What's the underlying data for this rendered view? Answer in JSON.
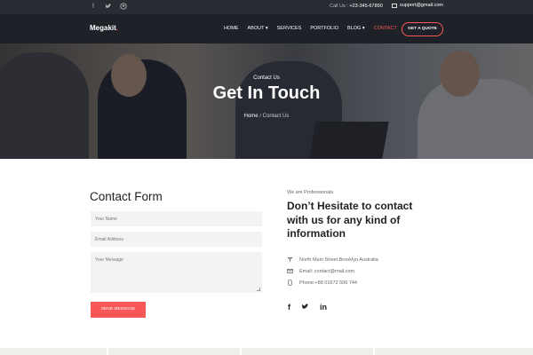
{
  "topbar": {
    "social_icons": [
      "facebook-icon",
      "twitter-icon",
      "github-icon"
    ],
    "call_label": "Call Us : ",
    "phone": "+23-345-67890",
    "email": "support@gmail.com"
  },
  "nav": {
    "logo_main": "Megakit",
    "logo_dot": ".",
    "items": [
      {
        "label": "HOME"
      },
      {
        "label": "ABOUT ▾"
      },
      {
        "label": "SERVICES"
      },
      {
        "label": "PORTFOLIO"
      },
      {
        "label": "BLOG ▾"
      },
      {
        "label": "CONTACT"
      }
    ],
    "cta": "GET A QUOTE"
  },
  "hero": {
    "subtitle": "Contact Us",
    "title": "Get In Touch",
    "crumb_home": "Home",
    "crumb_sep": " / ",
    "crumb_current": "Contact Us"
  },
  "form": {
    "title": "Contact Form",
    "name_placeholder": "Your Name",
    "email_placeholder": "Email Address",
    "message_placeholder": "Your Message",
    "submit": "SEND MESSAGE"
  },
  "info": {
    "eyebrow": "We are Professionals",
    "headline": "Don’t Hesitate to contact with us for any kind of information",
    "address": "North Main Street,Brooklyn Australia",
    "email": "Email: contact@mail.com",
    "phone": "Phone:+88 01672 506 744",
    "social": [
      "f",
      "t",
      "in"
    ]
  },
  "colors": {
    "accent": "#f75757",
    "dark": "#1f2128",
    "field_bg": "#f2f4f4"
  }
}
